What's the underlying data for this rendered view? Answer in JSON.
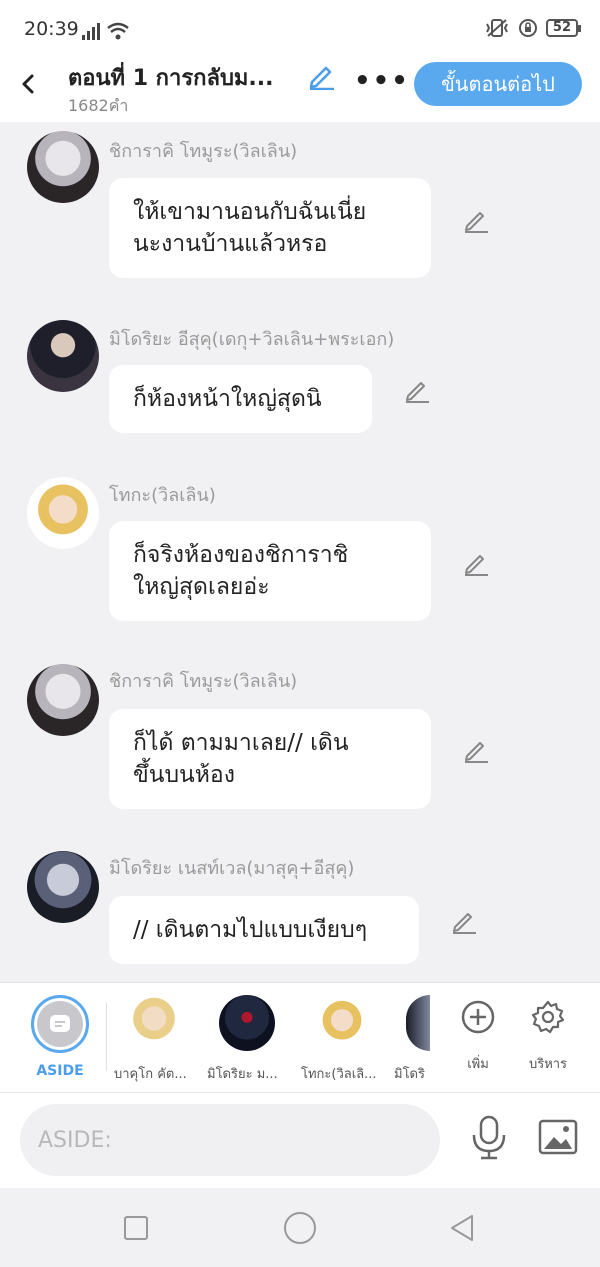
{
  "status": {
    "time": "20:39",
    "battery": "52"
  },
  "header": {
    "title": "ตอนที่ 1 การกลับม...",
    "word_count": "1682คำ",
    "next_button": "ขั้นตอนต่อไป"
  },
  "messages": [
    {
      "name": "ชิการาคิ โทมูระ(วิลเลิน)",
      "lines": [
        "ให้เขามานอนกับฉันเนี่ย",
        "นะงานบ้านแล้วหรอ"
      ]
    },
    {
      "name": "มิโดริยะ อีสุคุ(เดกุ+วิลเลิน+พระเอก)",
      "lines": [
        "ก็ห้องหน้าใหญ่สุดนิ"
      ]
    },
    {
      "name": "โทกะ(วิลเลิน)",
      "lines": [
        "ก็จริงห้องของชิการาชิ",
        "ใหญ่สุดเลยอ่ะ"
      ]
    },
    {
      "name": "ชิการาคิ โทมูระ(วิลเลิน)",
      "lines": [
        "ก็ได้ ตามมาเลย// เดิน",
        "ขึ้นบนห้อง"
      ]
    },
    {
      "name": "มิโดริยะ เนสท์เวล(มาสุคุ+อีสุคุ)",
      "lines": [
        "// เดินตามไปแบบเงียบๆ"
      ]
    }
  ],
  "character_bar": {
    "aside_label": "ASIDE",
    "characters": [
      {
        "label": "บาคุโก คัต..."
      },
      {
        "label": "มิโดริยะ ม..."
      },
      {
        "label": "โทกะ(วิลเลิ..."
      },
      {
        "label": "มิโดริ"
      }
    ],
    "add_label": "เพิ่ม",
    "manage_label": "บริหาร"
  },
  "input": {
    "placeholder": "ASIDE:"
  },
  "colors": {
    "accent": "#5aa9ef",
    "bubble": "#ffffff",
    "background": "#f1f1f3"
  },
  "icons": [
    "back-arrow-icon",
    "pencil-icon",
    "more-dots-icon",
    "plus-circle-icon",
    "gear-icon",
    "microphone-icon",
    "image-icon"
  ]
}
